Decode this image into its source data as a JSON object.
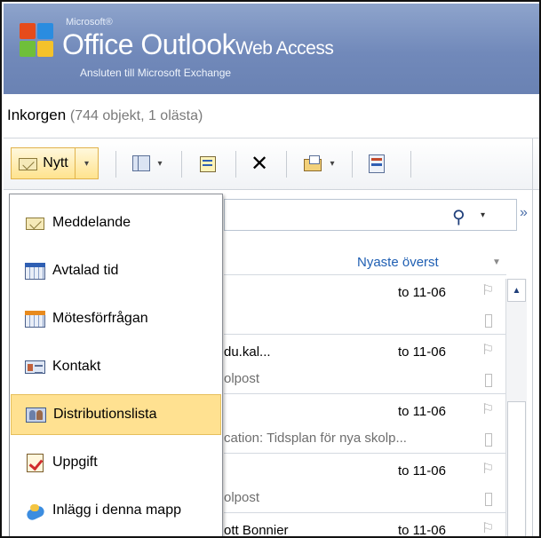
{
  "header": {
    "brand_small": "Microsoft®",
    "brand_main": "Office Outlook",
    "brand_suffix": "Web Access",
    "subtitle": "Ansluten till Microsoft Exchange",
    "logo_colors": [
      "#e64b1b",
      "#2a8ce0",
      "#6fbf3a",
      "#f4c22b"
    ]
  },
  "folder": {
    "name": "Inkorgen",
    "count_text": "(744 objekt, 1 olästa)"
  },
  "toolbar": {
    "new_label": "Nytt",
    "new_arrow": "▾",
    "view_arrow": "▾",
    "move_arrow": "▾",
    "delete_glyph": "✕"
  },
  "search": {
    "search_glyph": "⚲",
    "caret": "▾",
    "expand_glyph": "»"
  },
  "list": {
    "sort_label": "Nyaste överst",
    "sort_arrow": "▼",
    "rows": [
      {
        "sender": "",
        "date": "to 11-06",
        "subject": ""
      },
      {
        "sender": "du.kal...",
        "date": "to 11-06",
        "subject": "olpost"
      },
      {
        "sender": "",
        "date": "to 11-06",
        "subject": "cation: Tidsplan för nya skolp..."
      },
      {
        "sender": "",
        "date": "to 11-06",
        "subject": "olpost"
      },
      {
        "sender": "Lisclott Bonnier",
        "date": "to 11-06",
        "subject": ""
      }
    ]
  },
  "new_menu": {
    "items": [
      {
        "label": "Meddelande",
        "icon": "message-icon",
        "selected": false
      },
      {
        "label": "Avtalad tid",
        "icon": "appointment-icon",
        "selected": false
      },
      {
        "label": "Mötesförfrågan",
        "icon": "meeting-request-icon",
        "selected": false
      },
      {
        "label": "Kontakt",
        "icon": "contact-icon",
        "selected": false
      },
      {
        "label": "Distributionslista",
        "icon": "distribution-list-icon",
        "selected": true
      },
      {
        "label": "Uppgift",
        "icon": "task-icon",
        "selected": false
      },
      {
        "label": "Inlägg i denna mapp",
        "icon": "post-icon",
        "selected": false
      }
    ]
  },
  "colors": {
    "header_blue": "#7189ba",
    "highlight": "#ffe191",
    "link_blue": "#1f5fb3"
  }
}
